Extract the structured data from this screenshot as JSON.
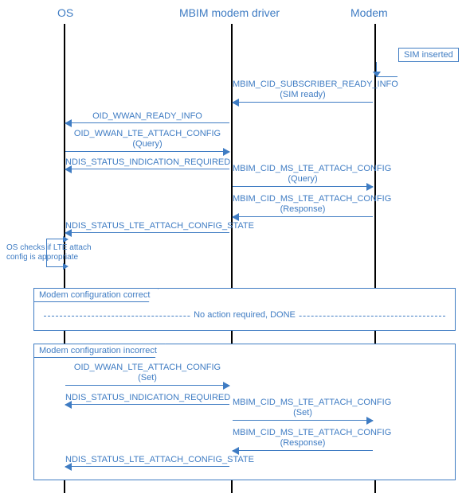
{
  "lanes": {
    "os": "OS",
    "driver": "MBIM modem driver",
    "modem": "Modem"
  },
  "sim_inserted": "SIM inserted",
  "messages": {
    "m1": "MBIM_CID_SUBSCRIBER_READY_INFO\n(SIM ready)",
    "m2": "OID_WWAN_READY_INFO",
    "m3": "OID_WWAN_LTE_ATTACH_CONFIG\n(Query)",
    "m4": "NDIS_STATUS_INDICATION_REQUIRED",
    "m5": "MBIM_CID_MS_LTE_ATTACH_CONFIG\n(Query)",
    "m6": "MBIM_CID_MS_LTE_ATTACH_CONFIG\n(Response)",
    "m7": "NDIS_STATUS_LTE_ATTACH_CONFIG_STATE",
    "m8": "OID_WWAN_LTE_ATTACH_CONFIG\n(Set)",
    "m9": "NDIS_STATUS_INDICATION_REQUIRED",
    "m10": "MBIM_CID_MS_LTE_ATTACH_CONFIG\n(Set)",
    "m11": "MBIM_CID_MS_LTE_ATTACH_CONFIG\n(Response)",
    "m12": "NDIS_STATUS_LTE_ATTACH_CONFIG_STATE"
  },
  "os_check_note": "OS checks if LTE attach\nconfig is appropriate",
  "frames": {
    "correct": {
      "title": "Modem configuration correct",
      "center": "No action required, DONE"
    },
    "incorrect": {
      "title": "Modem configuration incorrect"
    }
  },
  "colors": {
    "accent": "#3f7cc3",
    "line": "#000000",
    "bg": "#ffffff"
  }
}
